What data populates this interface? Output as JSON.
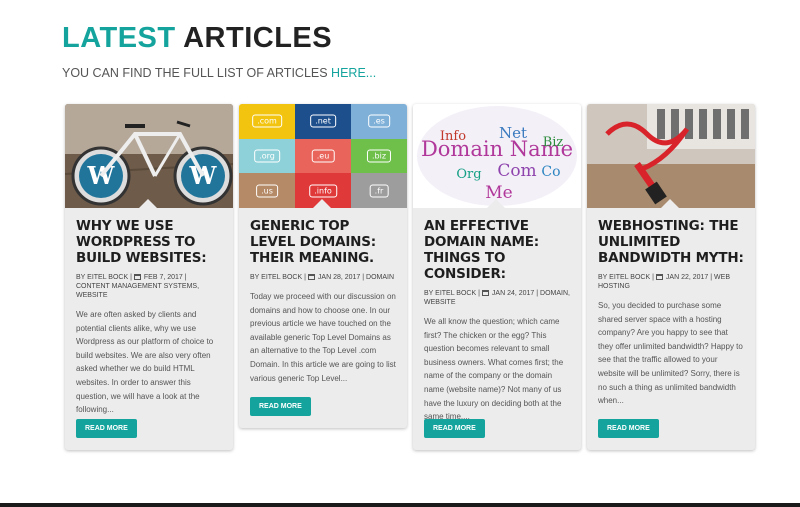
{
  "header": {
    "title_accent": "LATEST",
    "title_rest": "ARTICLES",
    "subtitle_prefix": "YOU CAN FIND THE FULL LIST OF ARTICLES ",
    "subtitle_link": "HERE..."
  },
  "cards": [
    {
      "title": "WHY WE USE WORDPRESS TO BUILD WEBSITES:",
      "author": "BY EITEL BOCK",
      "date": "FEB 7, 2017",
      "categories": "CONTENT MANAGEMENT SYSTEMS, WEBSITE",
      "excerpt": "We are often asked by clients and potential clients alike, why we use Wordpress as our platform of choice to build websites. We are also very often asked whether we do build HTML websites. In order to answer this question, we will have a look at the following...",
      "button": "READ MORE"
    },
    {
      "title": "GENERIC TOP LEVEL DOMAINS: THEIR MEANING.",
      "author": "BY EITEL BOCK",
      "date": "JAN 28, 2017",
      "categories": "DOMAIN",
      "excerpt": "Today we proceed with our discussion on domains and how to choose one. In our previous article we have touched on the available generic Top Level Domains as an alternative to the Top Level .com Domain. In this article we are going to list various generic Top Level...",
      "button": "READ MORE",
      "domains": [
        ".com",
        ".net",
        ".es",
        ".org",
        ".eu",
        ".biz",
        ".us",
        ".info",
        ".fr"
      ],
      "domain_colors": [
        "#f2c40f",
        "#1d4f8c",
        "#7fb0d8",
        "#8fd1d8",
        "#e9645a",
        "#6ec04b",
        "#b58a66",
        "#e0393a",
        "#9d9d9d"
      ]
    },
    {
      "title": "AN EFFECTIVE DOMAIN NAME: THINGS TO CONSIDER:",
      "author": "BY EITEL BOCK",
      "date": "JAN 24, 2017",
      "categories": "DOMAIN, WEBSITE",
      "excerpt": "We all know the question; which came first? The chicken or the egg? This question becomes relevant to small business owners. What comes first; the name of the company or the domain name (website name)? Not many of us have the luxury on deciding both at the same time....",
      "button": "READ MORE"
    },
    {
      "title": "WEBHOSTING: THE UNLIMITED BANDWIDTH MYTH:",
      "author": "BY EITEL BOCK",
      "date": "JAN 22, 2017",
      "categories": "WEB HOSTING",
      "excerpt": "So, you decided to purchase some shared server space with a hosting company? Are you happy to see that they offer unlimited bandwidth? Happy to see that the traffic allowed to your website will be unlimited? Sorry, there is no such a thing as unlimited bandwidth when...",
      "button": "READ MORE"
    }
  ],
  "wordcloud": [
    "Domain Name",
    "Net",
    "Biz",
    "Info",
    "Com",
    "Org",
    "Co",
    "Me"
  ]
}
